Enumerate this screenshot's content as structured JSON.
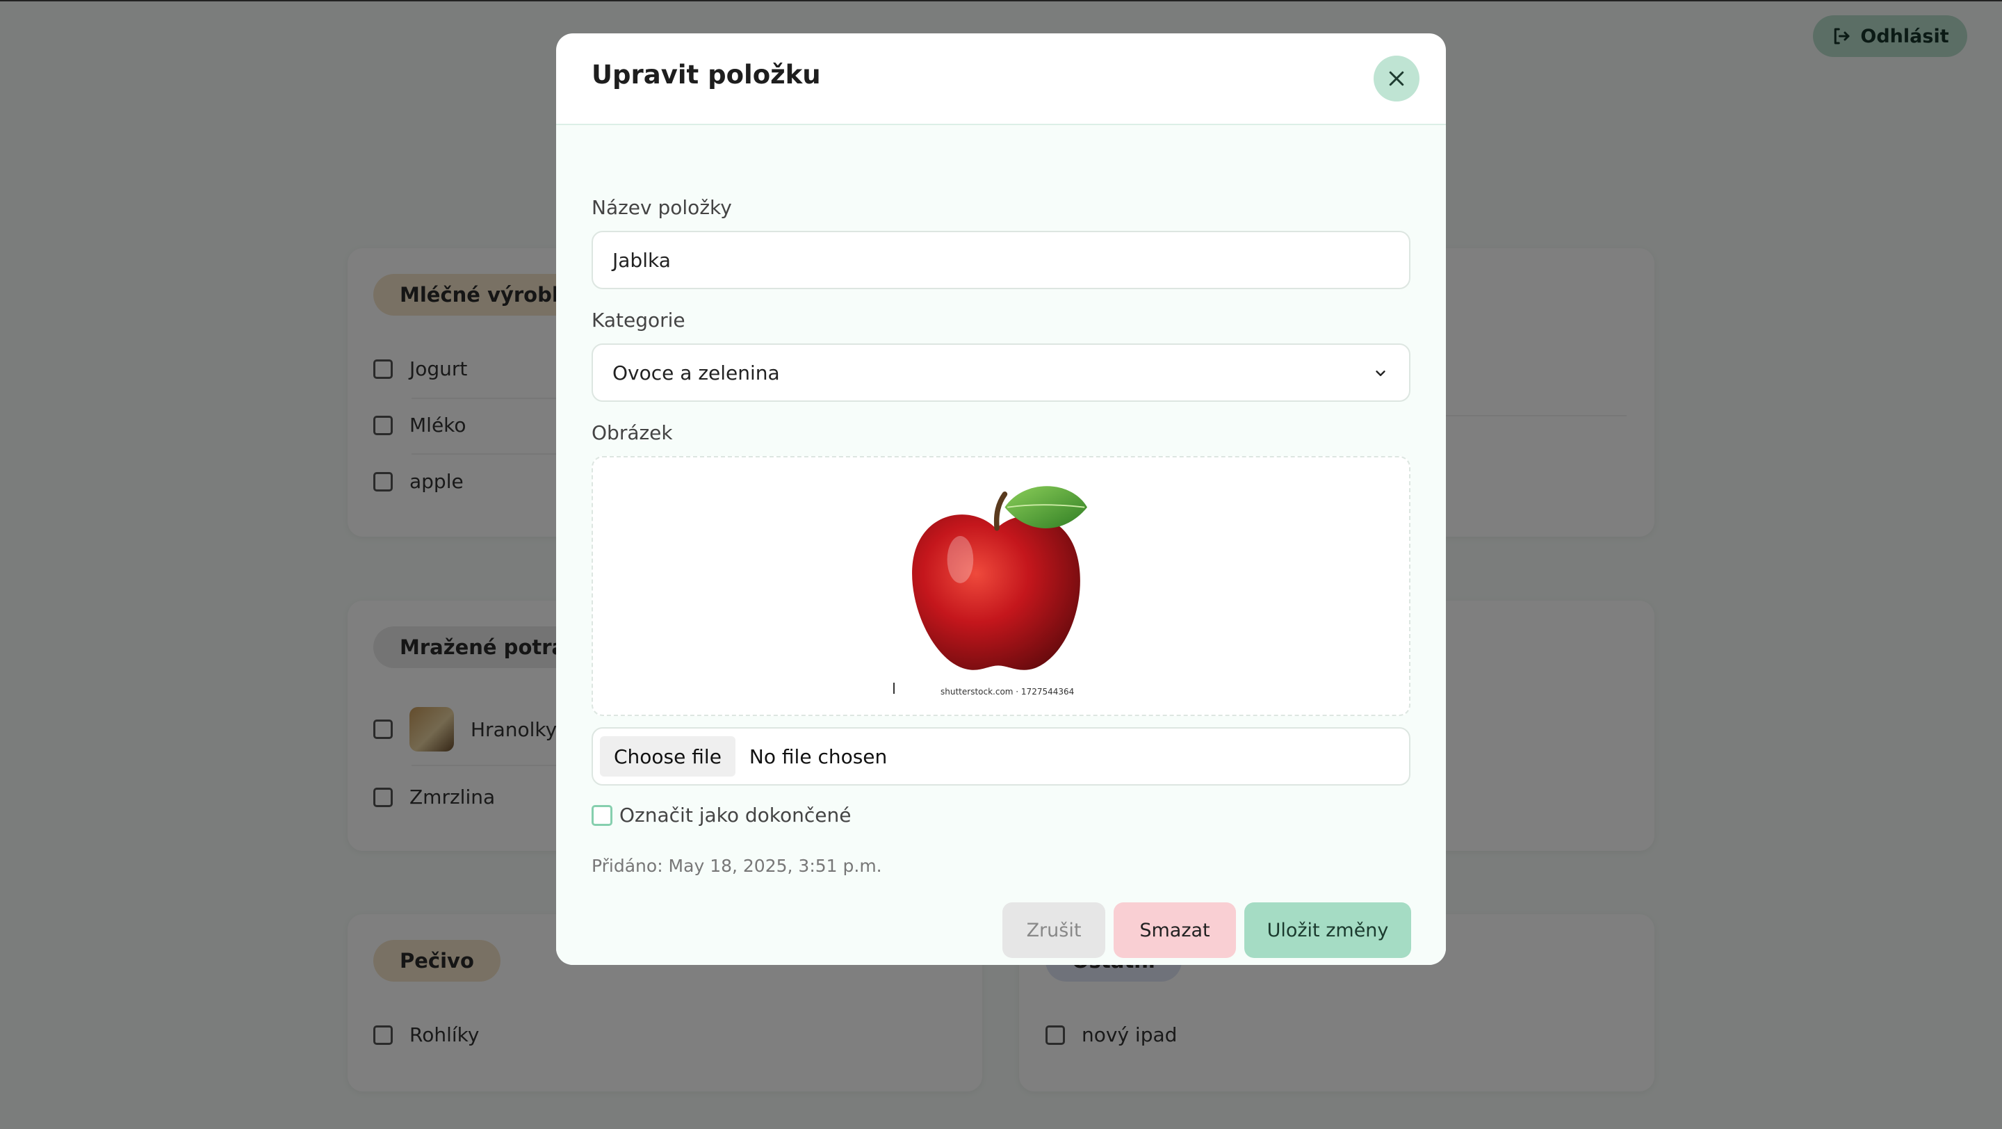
{
  "header": {
    "logout_label": "Odhlásit"
  },
  "categories": [
    {
      "name": "Mléčné výrobky",
      "color": "#f3e3c9",
      "items": [
        "Jogurt",
        "Mléko",
        "apple"
      ]
    },
    {
      "name": "Mražené potraviny",
      "color": "#e8e8e8",
      "items": [
        "Hranolky",
        "Zmrzlina"
      ]
    },
    {
      "name": "Pečivo",
      "color": "#f3e3c9",
      "items": [
        "Rohlíky"
      ]
    },
    {
      "name": "Ostatní",
      "color": "#dfe4f5",
      "items": [
        "nový ipad"
      ]
    }
  ],
  "modal": {
    "title": "Upravit položku",
    "name_label": "Název položky",
    "name_value": "Jablka",
    "category_label": "Kategorie",
    "category_value": "Ovoce a zelenina",
    "image_label": "Obrázek",
    "image_caption": "shutterstock.com · 1727544364",
    "choose_file_label": "Choose file",
    "no_file_label": "No file chosen",
    "done_label": "Označit jako dokončené",
    "done_checked": false,
    "added_text": "Přidáno: May 18, 2025, 3:51 p.m.",
    "cancel_label": "Zrušit",
    "delete_label": "Smazat",
    "save_label": "Uložit změny"
  },
  "colors": {
    "accent": "#a5dcc4",
    "delete": "#f9cfd3",
    "overlay": "rgba(0,0,0,0.5)"
  }
}
